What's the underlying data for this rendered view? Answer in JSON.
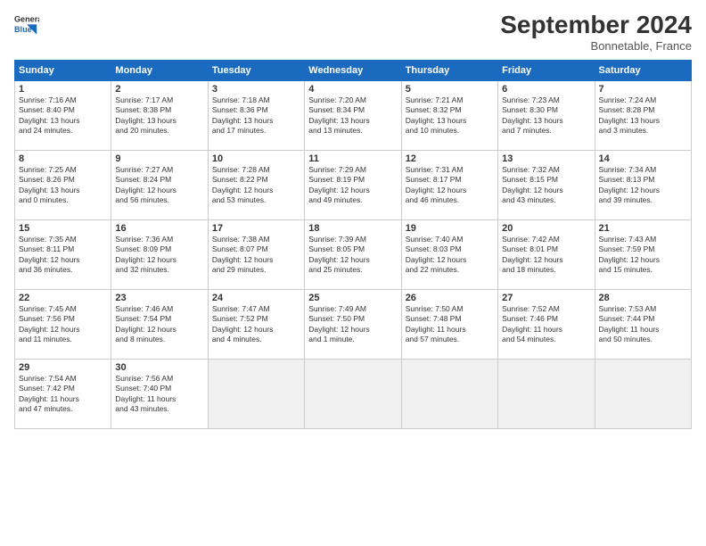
{
  "header": {
    "title": "September 2024",
    "subtitle": "Bonnetable, France"
  },
  "days": [
    "Sunday",
    "Monday",
    "Tuesday",
    "Wednesday",
    "Thursday",
    "Friday",
    "Saturday"
  ],
  "weeks": [
    [
      {
        "num": "1",
        "info": "Sunrise: 7:16 AM\nSunset: 8:40 PM\nDaylight: 13 hours\nand 24 minutes."
      },
      {
        "num": "2",
        "info": "Sunrise: 7:17 AM\nSunset: 8:38 PM\nDaylight: 13 hours\nand 20 minutes."
      },
      {
        "num": "3",
        "info": "Sunrise: 7:18 AM\nSunset: 8:36 PM\nDaylight: 13 hours\nand 17 minutes."
      },
      {
        "num": "4",
        "info": "Sunrise: 7:20 AM\nSunset: 8:34 PM\nDaylight: 13 hours\nand 13 minutes."
      },
      {
        "num": "5",
        "info": "Sunrise: 7:21 AM\nSunset: 8:32 PM\nDaylight: 13 hours\nand 10 minutes."
      },
      {
        "num": "6",
        "info": "Sunrise: 7:23 AM\nSunset: 8:30 PM\nDaylight: 13 hours\nand 7 minutes."
      },
      {
        "num": "7",
        "info": "Sunrise: 7:24 AM\nSunset: 8:28 PM\nDaylight: 13 hours\nand 3 minutes."
      }
    ],
    [
      {
        "num": "8",
        "info": "Sunrise: 7:25 AM\nSunset: 8:26 PM\nDaylight: 13 hours\nand 0 minutes."
      },
      {
        "num": "9",
        "info": "Sunrise: 7:27 AM\nSunset: 8:24 PM\nDaylight: 12 hours\nand 56 minutes."
      },
      {
        "num": "10",
        "info": "Sunrise: 7:28 AM\nSunset: 8:22 PM\nDaylight: 12 hours\nand 53 minutes."
      },
      {
        "num": "11",
        "info": "Sunrise: 7:29 AM\nSunset: 8:19 PM\nDaylight: 12 hours\nand 49 minutes."
      },
      {
        "num": "12",
        "info": "Sunrise: 7:31 AM\nSunset: 8:17 PM\nDaylight: 12 hours\nand 46 minutes."
      },
      {
        "num": "13",
        "info": "Sunrise: 7:32 AM\nSunset: 8:15 PM\nDaylight: 12 hours\nand 43 minutes."
      },
      {
        "num": "14",
        "info": "Sunrise: 7:34 AM\nSunset: 8:13 PM\nDaylight: 12 hours\nand 39 minutes."
      }
    ],
    [
      {
        "num": "15",
        "info": "Sunrise: 7:35 AM\nSunset: 8:11 PM\nDaylight: 12 hours\nand 36 minutes."
      },
      {
        "num": "16",
        "info": "Sunrise: 7:36 AM\nSunset: 8:09 PM\nDaylight: 12 hours\nand 32 minutes."
      },
      {
        "num": "17",
        "info": "Sunrise: 7:38 AM\nSunset: 8:07 PM\nDaylight: 12 hours\nand 29 minutes."
      },
      {
        "num": "18",
        "info": "Sunrise: 7:39 AM\nSunset: 8:05 PM\nDaylight: 12 hours\nand 25 minutes."
      },
      {
        "num": "19",
        "info": "Sunrise: 7:40 AM\nSunset: 8:03 PM\nDaylight: 12 hours\nand 22 minutes."
      },
      {
        "num": "20",
        "info": "Sunrise: 7:42 AM\nSunset: 8:01 PM\nDaylight: 12 hours\nand 18 minutes."
      },
      {
        "num": "21",
        "info": "Sunrise: 7:43 AM\nSunset: 7:59 PM\nDaylight: 12 hours\nand 15 minutes."
      }
    ],
    [
      {
        "num": "22",
        "info": "Sunrise: 7:45 AM\nSunset: 7:56 PM\nDaylight: 12 hours\nand 11 minutes."
      },
      {
        "num": "23",
        "info": "Sunrise: 7:46 AM\nSunset: 7:54 PM\nDaylight: 12 hours\nand 8 minutes."
      },
      {
        "num": "24",
        "info": "Sunrise: 7:47 AM\nSunset: 7:52 PM\nDaylight: 12 hours\nand 4 minutes."
      },
      {
        "num": "25",
        "info": "Sunrise: 7:49 AM\nSunset: 7:50 PM\nDaylight: 12 hours\nand 1 minute."
      },
      {
        "num": "26",
        "info": "Sunrise: 7:50 AM\nSunset: 7:48 PM\nDaylight: 11 hours\nand 57 minutes."
      },
      {
        "num": "27",
        "info": "Sunrise: 7:52 AM\nSunset: 7:46 PM\nDaylight: 11 hours\nand 54 minutes."
      },
      {
        "num": "28",
        "info": "Sunrise: 7:53 AM\nSunset: 7:44 PM\nDaylight: 11 hours\nand 50 minutes."
      }
    ],
    [
      {
        "num": "29",
        "info": "Sunrise: 7:54 AM\nSunset: 7:42 PM\nDaylight: 11 hours\nand 47 minutes."
      },
      {
        "num": "30",
        "info": "Sunrise: 7:56 AM\nSunset: 7:40 PM\nDaylight: 11 hours\nand 43 minutes."
      },
      {
        "empty": true
      },
      {
        "empty": true
      },
      {
        "empty": true
      },
      {
        "empty": true
      },
      {
        "empty": true
      }
    ]
  ]
}
